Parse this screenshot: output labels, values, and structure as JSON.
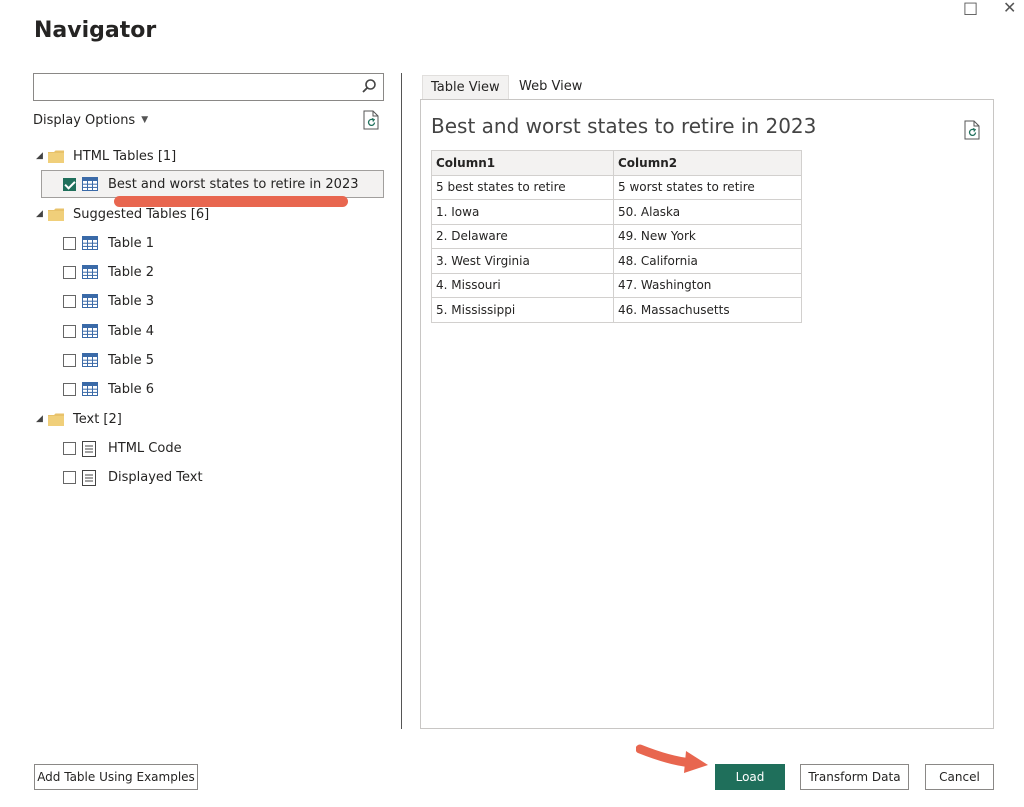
{
  "window": {
    "title": "Navigator",
    "maximize_glyph": "□",
    "close_glyph": "✕"
  },
  "left_pane": {
    "search": {
      "value": "",
      "placeholder": ""
    },
    "display_options_label": "Display Options",
    "tree": [
      {
        "label": "HTML Tables [1]",
        "type": "folder",
        "expanded": true
      },
      {
        "label": "Best and worst states to retire in 2023",
        "type": "table",
        "checked": true,
        "selected": true
      },
      {
        "label": "Suggested Tables [6]",
        "type": "folder",
        "expanded": true
      },
      {
        "label": "Table 1",
        "type": "table",
        "checked": false
      },
      {
        "label": "Table 2",
        "type": "table",
        "checked": false
      },
      {
        "label": "Table 3",
        "type": "table",
        "checked": false
      },
      {
        "label": "Table 4",
        "type": "table",
        "checked": false
      },
      {
        "label": "Table 5",
        "type": "table",
        "checked": false
      },
      {
        "label": "Table 6",
        "type": "table",
        "checked": false
      },
      {
        "label": "Text [2]",
        "type": "folder",
        "expanded": true
      },
      {
        "label": "HTML Code",
        "type": "text",
        "checked": false
      },
      {
        "label": "Displayed Text",
        "type": "text",
        "checked": false
      }
    ]
  },
  "right_pane": {
    "tabs": [
      {
        "label": "Table View",
        "active": true
      },
      {
        "label": "Web View",
        "active": false
      }
    ],
    "preview_title": "Best and worst states to retire in 2023",
    "table": {
      "headers": [
        "Column1",
        "Column2"
      ],
      "rows": [
        [
          "5 best states to retire",
          "5 worst states to retire"
        ],
        [
          "1. Iowa",
          "50. Alaska"
        ],
        [
          "2. Delaware",
          "49. New York"
        ],
        [
          "3. West Virginia",
          "48. California"
        ],
        [
          "4. Missouri",
          "47. Washington"
        ],
        [
          "5. Mississippi",
          "46. Massachusetts"
        ]
      ]
    }
  },
  "footer": {
    "add_table_label": "Add Table Using Examples",
    "load_label": "Load",
    "transform_label": "Transform Data",
    "cancel_label": "Cancel"
  },
  "colors": {
    "accent": "#1f6f5b",
    "annotation": "#e8664f",
    "folder": "#e8c26a",
    "table_icon": "#3a6aa8"
  },
  "icons": {
    "search": "search-icon",
    "refresh": "refresh-icon",
    "folder": "folder-icon",
    "table": "table-icon",
    "text": "text-document-icon",
    "arrow": "arrow-annotation"
  }
}
